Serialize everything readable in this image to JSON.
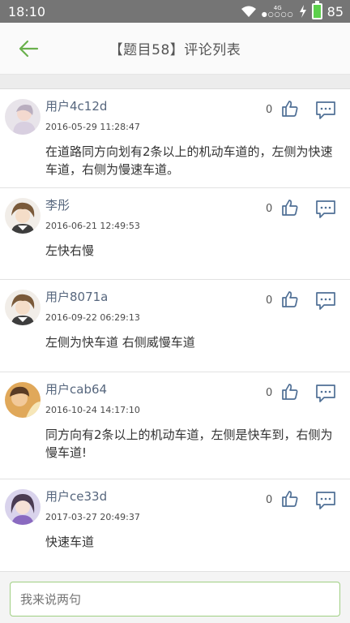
{
  "status_bar": {
    "time": "18:10",
    "network": "4G",
    "battery": "85"
  },
  "header": {
    "title": "【题目58】评论列表"
  },
  "comments": [
    {
      "user": "用户4c12d",
      "time": "2016-05-29 11:28:47",
      "likes": "0",
      "text": "在道路同方向划有2条以上的机动车道的，左侧为快速车道，右侧为慢速车道。"
    },
    {
      "user": "李彤",
      "time": "2016-06-21 12:49:53",
      "likes": "0",
      "text": "左快右慢"
    },
    {
      "user": "用户8071a",
      "time": "2016-09-22 06:29:13",
      "likes": "0",
      "text": "左侧为快车道 右侧威慢车道"
    },
    {
      "user": "用户cab64",
      "time": "2016-10-24 14:17:10",
      "likes": "0",
      "text": "同方向有2条以上的机动车道，左侧是快车到，右侧为慢车道!"
    },
    {
      "user": "用户ce33d",
      "time": "2017-03-27 20:49:37",
      "likes": "0",
      "text": "快速车道"
    }
  ],
  "input": {
    "placeholder": "我来说两句"
  },
  "colors": {
    "accent": "#6ab04c",
    "status_bar": "#757575",
    "username": "#57677e",
    "icon": "#4f6f95"
  }
}
